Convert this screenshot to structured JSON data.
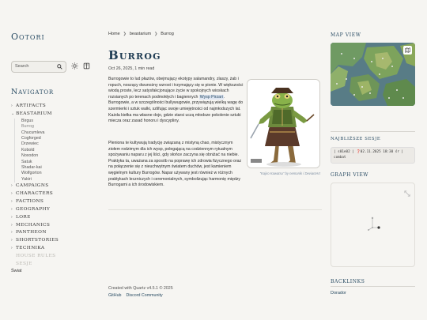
{
  "site": {
    "title": "Ootori"
  },
  "search": {
    "label": "Search"
  },
  "nav": {
    "title": "Navigator",
    "items": [
      {
        "label": "Artifacts",
        "open": false
      },
      {
        "label": "Beastarium",
        "open": true
      },
      {
        "label": "Campaigns",
        "open": false
      },
      {
        "label": "Characters",
        "open": false
      },
      {
        "label": "Factions",
        "open": false
      },
      {
        "label": "Geography",
        "open": false
      },
      {
        "label": "Lore",
        "open": false
      },
      {
        "label": "Mechanics",
        "open": false
      },
      {
        "label": "Pantheon",
        "open": false
      },
      {
        "label": "Shortstories",
        "open": false
      },
      {
        "label": "Technika",
        "open": false
      }
    ],
    "beastarium_sub": [
      "Birgus",
      "Burrog",
      "Chucumleva",
      "Cogforged",
      "Drzewiec",
      "Kobold",
      "Noxodon",
      "Satuk",
      "Shadar-kai",
      "Wolfgorton",
      "Yakiri"
    ],
    "active_sub": "Burrog",
    "faded_items": [
      "House rules",
      "Sesje"
    ],
    "bottom": "Świat"
  },
  "breadcrumb": [
    "Home",
    "beastarium",
    "Burrog"
  ],
  "page": {
    "title": "Burrog",
    "meta": "Oct 26, 2025, 1 min read",
    "p1_before": "Burrogowie to lud płazów, obejmujący ekotypy salamandry, zlaszy, żab i ropuch, noszący dwunożny wzrost i trzymający się w pionie. W większości wiodą proste, lecz satysfakcjonujące życie w spokojnych wioskach rozsianych po terenach podmokłych i bagiennych ",
    "p1_link": "Wysp Pirzari",
    "p1_after": ". Burrogowie, a w szczególności bullywugowie, przywiązują wielką wagę do szermierki i sztuk walki, szlifując swoje umiejętności od najmłodszych lat. Każda kiełka ma własne dojo, gdzie starsi uczą młodsze pokolenie sztuki miecza oraz zasad honoru i dyscypliny.",
    "p2": "Pleniona te kultywują tradycję związaną z mistyną chao, mistycznym ziołem rodzimym dla ich wysp, polegającą na codziennym rytualnym spożywaniu naparu z jej liści, gdy słońce zaczyna się obniżać na niebie. Praktyka ta, uważana za sposób na poprawę ich zdrowia fizycznego oraz na połączenie się z nieuchwytnym światem duchów, jest kamieniem węgielnym kultury Burrogów. Napar używany jest również w różnych praktykach leczniczych i ceremonialnych, symbolizując harmonię między Burrogami a ich środowiskiem.",
    "caption": "\"Kajiro Kawatsu\" by nemonik / DeviantArt"
  },
  "footer": {
    "created": "Created with Quartz v4.5.1 © 2025",
    "links": [
      "GitHub",
      "Discord Community"
    ]
  },
  "right": {
    "map_title": "Map View",
    "sessions_title": "Najbliższe sesje",
    "sessions_text": "| s01e02 | ❓02.11.2025 18:30 śr | combat",
    "graph_title": "Graph View",
    "backlinks_title": "Backlinks",
    "backlink": "Dorador"
  },
  "colors": {
    "accent": "#284b63",
    "bg": "#f6f5f2",
    "highlight": "#dfe6f2"
  },
  "icons": [
    "search-icon",
    "sun-icon",
    "book-icon",
    "chevron-right-icon",
    "chevron-down-icon",
    "map-icon",
    "expand-icon"
  ]
}
